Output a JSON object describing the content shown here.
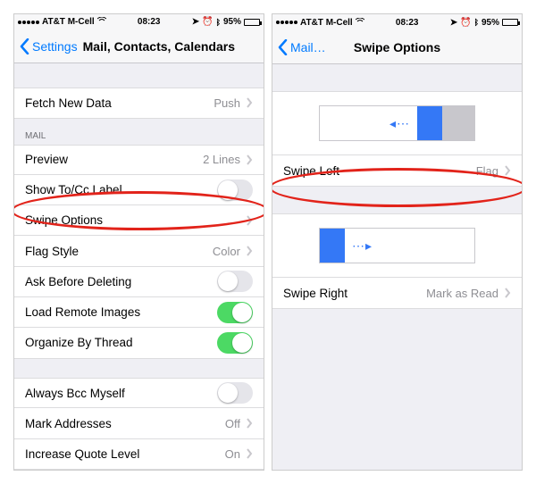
{
  "leftScreen": {
    "status": {
      "carrier": "AT&T M-Cell",
      "time": "08:23",
      "battery": "95%"
    },
    "nav": {
      "back": "Settings",
      "title": "Mail, Contacts, Calendars"
    },
    "rows": {
      "fetch": {
        "label": "Fetch New Data",
        "value": "Push"
      },
      "mailHeader": "MAIL",
      "preview": {
        "label": "Preview",
        "value": "2 Lines"
      },
      "showTo": {
        "label": "Show To/Cc Label"
      },
      "swipe": {
        "label": "Swipe Options"
      },
      "flag": {
        "label": "Flag Style",
        "value": "Color"
      },
      "ask": {
        "label": "Ask Before Deleting"
      },
      "load": {
        "label": "Load Remote Images"
      },
      "org": {
        "label": "Organize By Thread"
      },
      "bcc": {
        "label": "Always Bcc Myself"
      },
      "mark": {
        "label": "Mark Addresses",
        "value": "Off"
      },
      "quote": {
        "label": "Increase Quote Level",
        "value": "On"
      }
    },
    "toggles": {
      "showTo": false,
      "ask": false,
      "load": true,
      "org": true,
      "bcc": false
    }
  },
  "rightScreen": {
    "status": {
      "carrier": "AT&T M-Cell",
      "time": "08:23",
      "battery": "95%"
    },
    "nav": {
      "back": "Mail…",
      "title": "Swipe Options"
    },
    "rows": {
      "left": {
        "label": "Swipe Left",
        "value": "Flag"
      },
      "right": {
        "label": "Swipe Right",
        "value": "Mark as Read"
      }
    }
  }
}
